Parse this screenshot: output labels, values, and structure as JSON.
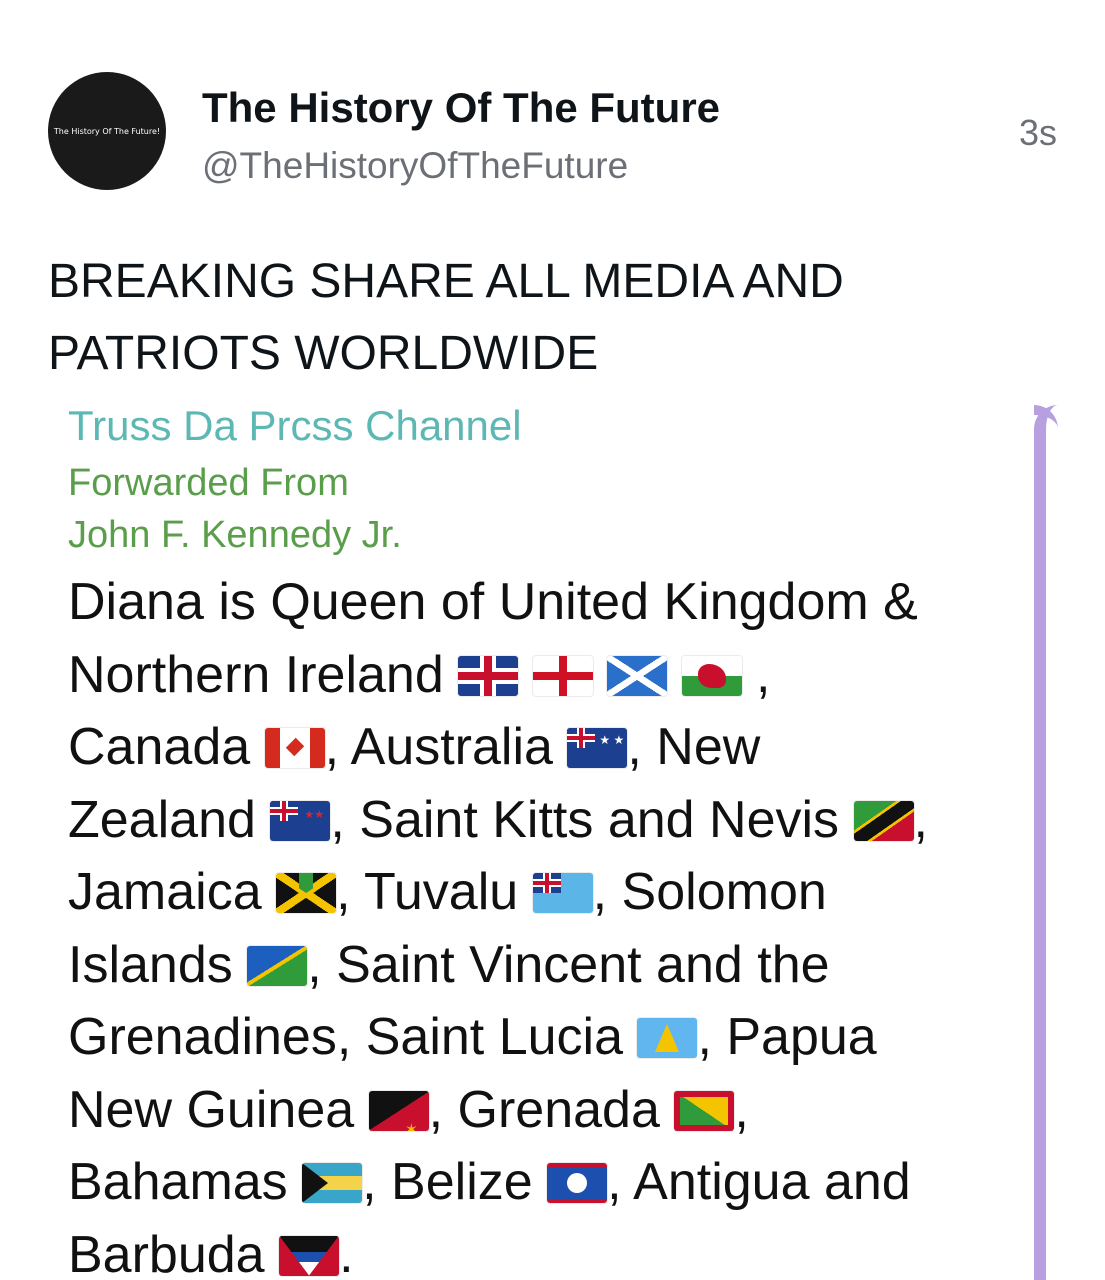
{
  "post": {
    "avatar_text": "The History Of The Future!",
    "author_name": "The History Of The Future",
    "author_handle": "@TheHistoryOfTheFuture",
    "timestamp": "3s",
    "text_lines": [
      "BREAKING SHARE ALL MEDIA AND",
      "PATRIOTS WORLDWIDE"
    ]
  },
  "forward": {
    "channel": "Truss Da Prcss Channel",
    "forwarded_label": "Forwarded From",
    "forwarded_from": "John F. Kennedy Jr.",
    "message": {
      "l1": "Diana is Queen of United Kingdom &",
      "l2a": "Northern Ireland",
      "l2b": ",",
      "l3a": "Canada",
      "l3b": ", Australia",
      "l3c": ", New",
      "l4a": "Zealand",
      "l4b": ", Saint Kitts and Nevis",
      "l4c": ",",
      "l5a": "Jamaica",
      "l5b": ", Tuvalu",
      "l5c": ", Solomon",
      "l6a": "Islands",
      "l6b": ",  Saint Vincent and the",
      "l7a": "Grenadines, Saint Lucia",
      "l7b": ", Papua",
      "l8a": "New Guinea",
      "l8b": ", Grenada",
      "l8c": ",",
      "l9a": "Bahamas",
      "l9b": ", Belize",
      "l9c": ", Antigua and",
      "l10a": "Barbuda",
      "l10b": "."
    }
  },
  "colors": {
    "channel": "#5db8b4",
    "forwarded": "#5a9e4b",
    "accent_bar": "#b79fe0"
  },
  "icons": {
    "flags": [
      "flag-uk-icon",
      "flag-england-icon",
      "flag-scotland-icon",
      "flag-wales-icon",
      "flag-canada-icon",
      "flag-australia-icon",
      "flag-new-zealand-icon",
      "flag-saint-kitts-icon",
      "flag-jamaica-icon",
      "flag-tuvalu-icon",
      "flag-solomon-islands-icon",
      "flag-saint-lucia-icon",
      "flag-papua-new-guinea-icon",
      "flag-grenada-icon",
      "flag-bahamas-icon",
      "flag-belize-icon",
      "flag-antigua-icon"
    ]
  }
}
